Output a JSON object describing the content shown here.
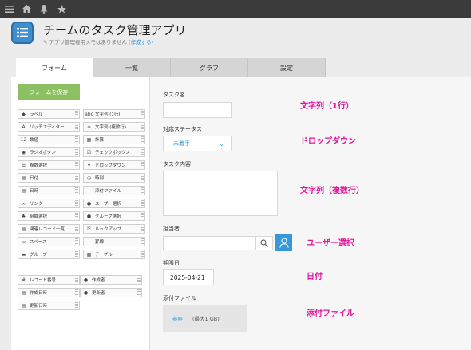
{
  "topbar": {
    "icons": [
      "menu-icon",
      "home-icon",
      "bell-icon",
      "star-icon"
    ]
  },
  "app": {
    "title": "チームのタスク管理アプリ",
    "memo_text": "アプリ管理者用メモはありません",
    "memo_link": "(作成する)"
  },
  "tabs": [
    {
      "label": "フォーム",
      "active": true
    },
    {
      "label": "一覧",
      "active": false
    },
    {
      "label": "グラフ",
      "active": false
    },
    {
      "label": "設定",
      "active": false
    }
  ],
  "palette": {
    "save_label": "フォームを保存",
    "items": [
      {
        "label": "ラベル",
        "icon": "label-icon"
      },
      {
        "label": "文字列 (1行)",
        "icon": "text-single-icon"
      },
      {
        "label": "リッチエディター",
        "icon": "rich-editor-icon"
      },
      {
        "label": "文字列 (複数行)",
        "icon": "text-multi-icon"
      },
      {
        "label": "数値",
        "icon": "number-icon"
      },
      {
        "label": "計算",
        "icon": "calc-icon"
      },
      {
        "label": "ラジオボタン",
        "icon": "radio-icon"
      },
      {
        "label": "チェックボックス",
        "icon": "checkbox-icon"
      },
      {
        "label": "複数選択",
        "icon": "multi-select-icon"
      },
      {
        "label": "ドロップダウン",
        "icon": "dropdown-icon"
      },
      {
        "label": "日付",
        "icon": "date-icon"
      },
      {
        "label": "時刻",
        "icon": "time-icon"
      },
      {
        "label": "日時",
        "icon": "datetime-icon"
      },
      {
        "label": "添付ファイル",
        "icon": "attachment-icon"
      },
      {
        "label": "リンク",
        "icon": "link-icon"
      },
      {
        "label": "ユーザー選択",
        "icon": "user-select-icon"
      },
      {
        "label": "組織選択",
        "icon": "org-select-icon"
      },
      {
        "label": "グループ選択",
        "icon": "group-select-icon"
      },
      {
        "label": "関連レコード一覧",
        "icon": "related-records-icon"
      },
      {
        "label": "ルックアップ",
        "icon": "lookup-icon"
      },
      {
        "label": "スペース",
        "icon": "space-icon"
      },
      {
        "label": "罫線",
        "icon": "rule-icon"
      },
      {
        "label": "グループ",
        "icon": "group-icon"
      },
      {
        "label": "テーブル",
        "icon": "table-icon"
      }
    ],
    "system_items": [
      {
        "label": "レコード番号",
        "icon": "record-number-icon"
      },
      {
        "label": "作成者",
        "icon": "creator-icon"
      },
      {
        "label": "作成日時",
        "icon": "created-at-icon"
      },
      {
        "label": "更新者",
        "icon": "updater-icon"
      },
      {
        "label": "更新日時",
        "icon": "updated-at-icon"
      }
    ]
  },
  "form": {
    "task_name_label": "タスク名",
    "status_label": "対応ステータス",
    "status_value": "未着手",
    "content_label": "タスク内容",
    "assignee_label": "担当者",
    "due_label": "期限日",
    "due_value": "2025-04-21",
    "attach_label": "添付ファイル",
    "attach_link": "参照",
    "attach_limit": "(最大1 GB)"
  },
  "annotations": {
    "text_single": "文字列（1行）",
    "dropdown": "ドロップダウン",
    "text_multi": "文字列（複数行）",
    "user_select": "ユーザー選択",
    "date": "日付",
    "attachment": "添付ファイル"
  }
}
